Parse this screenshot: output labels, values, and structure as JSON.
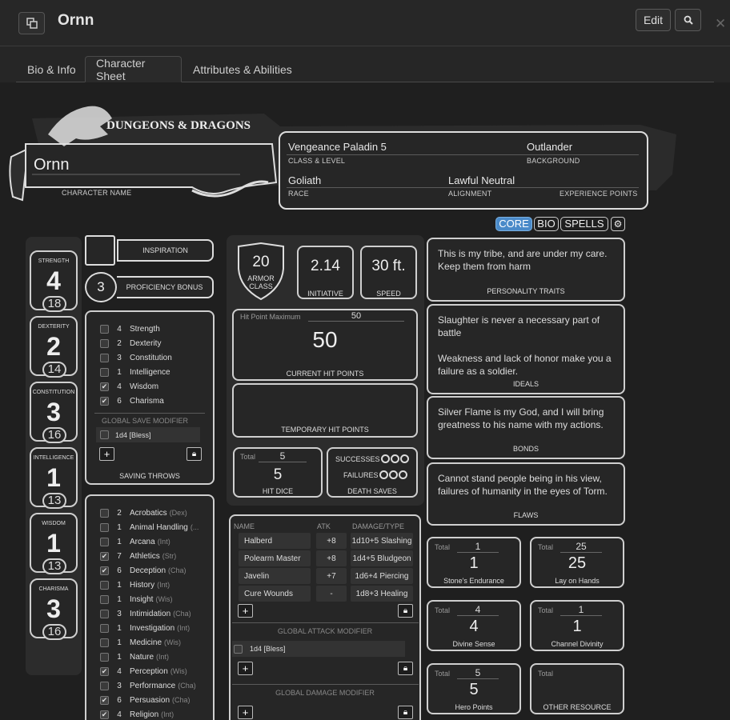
{
  "header": {
    "title": "Ornn",
    "edit_label": "Edit"
  },
  "tabs": [
    {
      "label": "Bio & Info"
    },
    {
      "label": "Character Sheet"
    },
    {
      "label": "Attributes & Abilities"
    }
  ],
  "banner": {
    "logo_text": "DUNGEONS & DRAGONS",
    "character_name": "Ornn",
    "character_name_label": "CHARACTER NAME",
    "class_level": "Vengeance Paladin 5",
    "class_level_label": "CLASS & LEVEL",
    "background": "Outlander",
    "background_label": "BACKGROUND",
    "race": "Goliath",
    "race_label": "RACE",
    "alignment": "Lawful Neutral",
    "alignment_label": "ALIGNMENT",
    "experience_label": "EXPERIENCE POINTS"
  },
  "view_buttons": {
    "core": "CORE",
    "bio": "BIO",
    "spells": "SPELLS"
  },
  "abilities": [
    {
      "name": "STRENGTH",
      "mod": "4",
      "score": "18"
    },
    {
      "name": "DEXTERITY",
      "mod": "2",
      "score": "14"
    },
    {
      "name": "CONSTITUTION",
      "mod": "3",
      "score": "16"
    },
    {
      "name": "INTELLIGENCE",
      "mod": "1",
      "score": "13"
    },
    {
      "name": "WISDOM",
      "mod": "1",
      "score": "13"
    },
    {
      "name": "CHARISMA",
      "mod": "3",
      "score": "16"
    }
  ],
  "inspiration_label": "INSPIRATION",
  "proficiency": {
    "value": "3",
    "label": "PROFICIENCY BONUS"
  },
  "saving_throws": {
    "items": [
      {
        "value": "4",
        "name": "Strength",
        "checked": false
      },
      {
        "value": "2",
        "name": "Dexterity",
        "checked": false
      },
      {
        "value": "3",
        "name": "Constitution",
        "checked": false
      },
      {
        "value": "1",
        "name": "Intelligence",
        "checked": false
      },
      {
        "value": "4",
        "name": "Wisdom",
        "checked": true
      },
      {
        "value": "6",
        "name": "Charisma",
        "checked": true
      }
    ],
    "global_label": "GLOBAL SAVE MODIFIER",
    "global_item": "1d4 [Bless]",
    "title": "SAVING THROWS"
  },
  "skills": [
    {
      "value": "2",
      "name": "Acrobatics",
      "attr": "(Dex)",
      "checked": false
    },
    {
      "value": "1",
      "name": "Animal Handling",
      "attr": "(...",
      "checked": false
    },
    {
      "value": "1",
      "name": "Arcana",
      "attr": "(Int)",
      "checked": false
    },
    {
      "value": "7",
      "name": "Athletics",
      "attr": "(Str)",
      "checked": true
    },
    {
      "value": "6",
      "name": "Deception",
      "attr": "(Cha)",
      "checked": true
    },
    {
      "value": "1",
      "name": "History",
      "attr": "(Int)",
      "checked": false
    },
    {
      "value": "1",
      "name": "Insight",
      "attr": "(Wis)",
      "checked": false
    },
    {
      "value": "3",
      "name": "Intimidation",
      "attr": "(Cha)",
      "checked": false
    },
    {
      "value": "1",
      "name": "Investigation",
      "attr": "(Int)",
      "checked": false
    },
    {
      "value": "1",
      "name": "Medicine",
      "attr": "(Wis)",
      "checked": false
    },
    {
      "value": "1",
      "name": "Nature",
      "attr": "(Int)",
      "checked": false
    },
    {
      "value": "4",
      "name": "Perception",
      "attr": "(Wis)",
      "checked": true
    },
    {
      "value": "3",
      "name": "Performance",
      "attr": "(Cha)",
      "checked": false
    },
    {
      "value": "6",
      "name": "Persuasion",
      "attr": "(Cha)",
      "checked": true
    },
    {
      "value": "4",
      "name": "Religion",
      "attr": "(Int)",
      "checked": true
    }
  ],
  "combat": {
    "ac": "20",
    "ac_label": "ARMOR CLASS",
    "initiative": "2.14",
    "initiative_label": "INITIATIVE",
    "speed": "30 ft.",
    "speed_label": "SPEED",
    "hp_max_label": "Hit Point Maximum",
    "hp_max": "50",
    "hp_current": "50",
    "hp_current_label": "CURRENT HIT POINTS",
    "temp_hp_label": "TEMPORARY HIT POINTS",
    "hit_dice_total_label": "Total",
    "hit_dice_total": "5",
    "hit_dice": "5",
    "hit_dice_label": "HIT DICE",
    "successes_label": "SUCCESSES",
    "failures_label": "FAILURES",
    "death_saves_label": "DEATH SAVES"
  },
  "attacks": {
    "headers": {
      "name": "NAME",
      "atk": "ATK",
      "damage": "DAMAGE/TYPE"
    },
    "rows": [
      {
        "name": "Halberd",
        "atk": "+8",
        "damage": "1d10+5 Slashing"
      },
      {
        "name": "Polearm Master",
        "atk": "+8",
        "damage": "1d4+5 Bludgeon"
      },
      {
        "name": "Javelin",
        "atk": "+7",
        "damage": "1d6+4 Piercing"
      },
      {
        "name": "Cure Wounds",
        "atk": "-",
        "damage": "1d8+3 Healing"
      }
    ],
    "global_attack_label": "GLOBAL ATTACK MODIFIER",
    "global_attack_item": "1d4 [Bless]",
    "global_damage_label": "GLOBAL DAMAGE MODIFIER"
  },
  "traits": {
    "personality": "This is my tribe, and are under my care. Keep them from harm",
    "personality_label": "PERSONALITY TRAITS",
    "ideals_1": "Slaughter is never a necessary part of battle",
    "ideals_2": "Weakness and lack of honor make you a failure as a soldier.",
    "ideals_label": "IDEALS",
    "bonds": "Silver Flame is my God, and I will bring greatness to his name with my actions.",
    "bonds_label": "BONDS",
    "flaws": "Cannot stand people being in his view, failures of humanity in the eyes of Torm.",
    "flaws_label": "FLAWS"
  },
  "resources": [
    {
      "total_label": "Total",
      "total": "1",
      "value": "1",
      "name": "Stone's Endurance"
    },
    {
      "total_label": "Total",
      "total": "25",
      "value": "25",
      "name": "Lay on Hands"
    },
    {
      "total_label": "Total",
      "total": "4",
      "value": "4",
      "name": "Divine Sense"
    },
    {
      "total_label": "Total",
      "total": "1",
      "value": "1",
      "name": "Channel Divinity"
    },
    {
      "total_label": "Total",
      "total": "5",
      "value": "5",
      "name": "Hero Points"
    },
    {
      "total_label": "Total",
      "total": "",
      "value": "",
      "name": "OTHER RESOURCE"
    }
  ]
}
